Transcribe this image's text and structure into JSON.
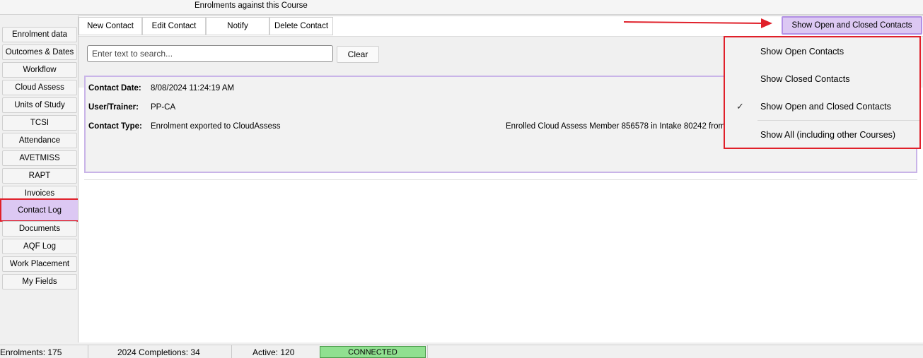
{
  "window": {
    "title": "Enrolments against this Course"
  },
  "sidebar": {
    "tabs": [
      {
        "label": "Enrolment data"
      },
      {
        "label": "Outcomes & Dates"
      },
      {
        "label": "Workflow"
      },
      {
        "label": "Cloud Assess"
      },
      {
        "label": "Units of Study"
      },
      {
        "label": "TCSI"
      },
      {
        "label": "Attendance"
      },
      {
        "label": "AVETMISS"
      },
      {
        "label": "RAPT"
      },
      {
        "label": "Invoices"
      },
      {
        "label": "Contact Log",
        "active": true
      },
      {
        "label": "Documents"
      },
      {
        "label": "AQF Log"
      },
      {
        "label": "Work Placement"
      },
      {
        "label": "My Fields"
      }
    ]
  },
  "toolbar": {
    "new_contact": "New Contact",
    "edit_contact": "Edit Contact",
    "notify": "Notify",
    "delete_contact": "Delete Contact",
    "show_filter": "Show Open and Closed Contacts"
  },
  "search": {
    "placeholder": "Enter text to search...",
    "clear_label": "Clear"
  },
  "contact": {
    "date_label": "Contact Date:",
    "date_value": "8/08/2024 11:24:19 AM",
    "user_label": "User/Trainer:",
    "user_value": "PP-CA",
    "type_label": "Contact Type:",
    "type_value": "Enrolment exported to CloudAssess",
    "note": "Enrolled Cloud Assess Member 856578 in Intake 80242 from the"
  },
  "filter_menu": {
    "items": [
      {
        "label": "Show Open Contacts",
        "checked": false
      },
      {
        "label": "Show Closed Contacts",
        "checked": false
      },
      {
        "label": "Show Open and Closed Contacts",
        "checked": true
      },
      {
        "label": "Show All (including other Courses)",
        "checked": false
      }
    ],
    "check_glyph": "✓"
  },
  "status": {
    "enrolments": "Enrolments: 175",
    "completions": "2024 Completions: 34",
    "active": "Active: 120",
    "connection": "CONNECTED"
  },
  "colors": {
    "highlight_red": "#e0202a",
    "selected_purple": "#dcc8f3",
    "connected_green": "#90e090"
  }
}
